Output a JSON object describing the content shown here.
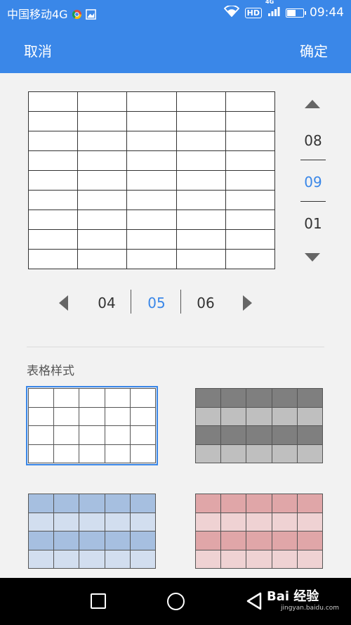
{
  "status_bar": {
    "carrier": "中国移动4G",
    "network_badge": "4G",
    "hd_badge": "HD",
    "time": "09:44",
    "battery_level": 0.55,
    "icons": [
      "chrome-icon",
      "image-icon",
      "wifi-icon",
      "signal-icon",
      "battery-icon"
    ]
  },
  "action_bar": {
    "cancel_label": "取消",
    "confirm_label": "确定"
  },
  "row_picker": {
    "values": [
      "08",
      "09",
      "01"
    ],
    "selected_index": 1
  },
  "column_picker": {
    "values": [
      "04",
      "05",
      "06"
    ],
    "selected_index": 1
  },
  "preview_grid": {
    "rows": 9,
    "cols": 5
  },
  "table_styles": {
    "title": "表格样式",
    "selected_index": 0,
    "styles": [
      {
        "name": "plain",
        "header": "#ffffff",
        "alt1": "#ffffff",
        "alt2": "#ffffff"
      },
      {
        "name": "gray",
        "header": "#7f7f7f",
        "alt1": "#bfbfbf",
        "alt2": "#7f7f7f"
      },
      {
        "name": "blue",
        "header": "#a6bfe0",
        "alt1": "#d2deef",
        "alt2": "#a6bfe0"
      },
      {
        "name": "red",
        "header": "#e0a6a8",
        "alt1": "#efd2d3",
        "alt2": "#e0a6a8"
      }
    ]
  },
  "watermark": {
    "brand": "Bai 经验",
    "url": "jingyan.baidu.com"
  },
  "colors": {
    "accent": "#3a87e8"
  }
}
